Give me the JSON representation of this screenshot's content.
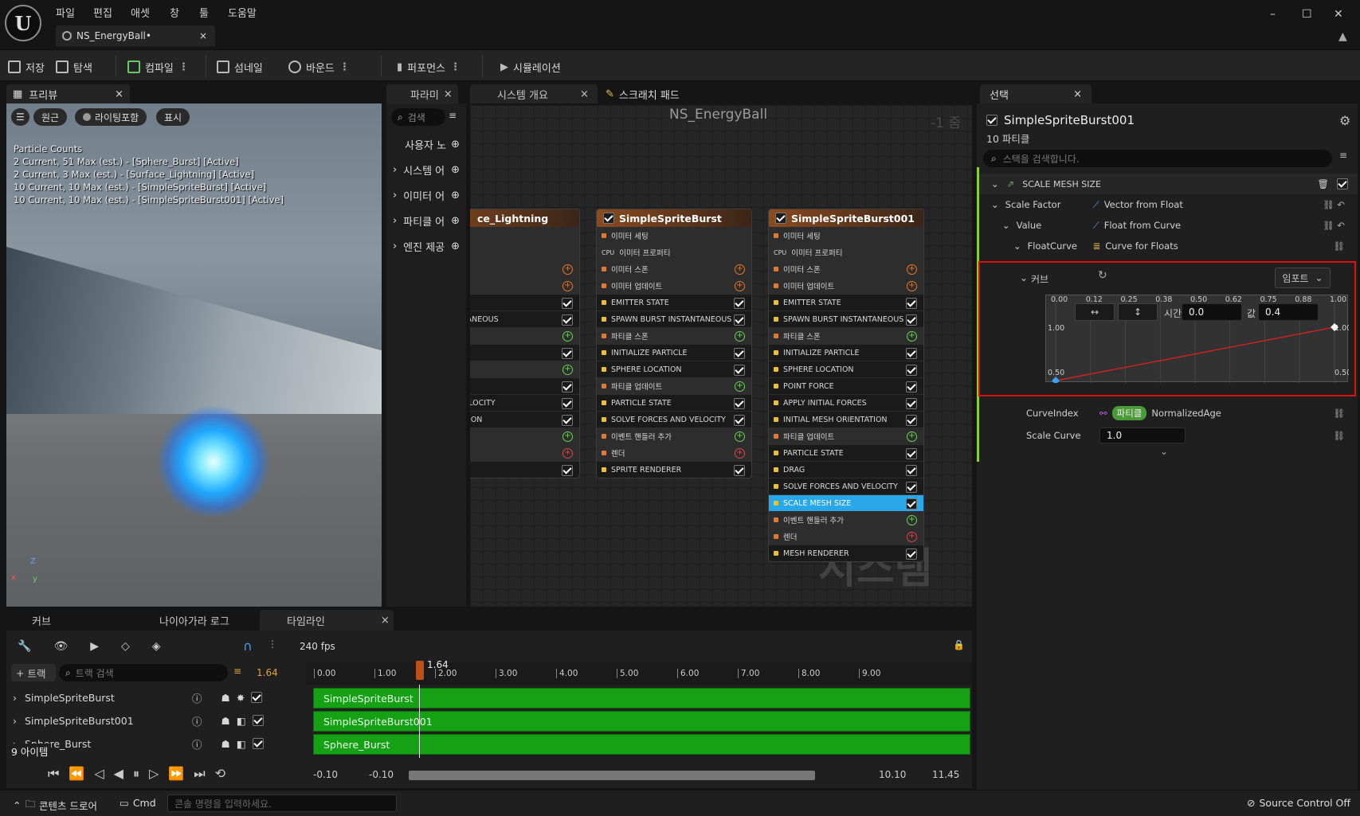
{
  "menu": [
    "파일",
    "편집",
    "애셋",
    "창",
    "툴",
    "도움말"
  ],
  "logo": "U",
  "doc_tab": {
    "title": "NS_EnergyBall•",
    "close": "×"
  },
  "window": {
    "minimize": "–",
    "maximize": "☐",
    "close": "✕"
  },
  "toolbar": {
    "save": "저장",
    "browse": "탐색",
    "compile": "컴파일",
    "thumbnail": "섬네일",
    "bounds": "바운드",
    "performance": "퍼포먼스",
    "simulation": "시뮬레이션"
  },
  "preview": {
    "tab": "프리뷰",
    "close": "×",
    "btn_persp": "원근",
    "btn_lit": "라이팅포함",
    "btn_show": "표시",
    "stats": [
      "Particle Counts",
      "2 Current, 51 Max (est.) - [Sphere_Burst] [Active]",
      "2 Current, 3 Max (est.) - [Surface_Lightning] [Active]",
      "10 Current, 10 Max (est.) - [SimpleSpriteBurst] [Active]",
      "10 Current, 10 Max (est.) - [SimpleSpriteBurst001] [Active]"
    ],
    "axis_z": "Z",
    "axis_x": "x",
    "axis_y": "y"
  },
  "graph": {
    "tabs": [
      "파라미",
      "시스템 개요",
      "스크래치 패드"
    ],
    "title": "NS_EnergyBall",
    "zoom": "-1 줌",
    "watermark": "시스템",
    "palette": {
      "search": "검색",
      "items": [
        "사용자 노",
        "시스템 어",
        "이미터 어",
        "파티클 어",
        "엔진 제공"
      ]
    },
    "node1": {
      "title": "ce_Lightning",
      "rows": [
        "팅",
        "로퍼티",
        "폰",
        "데이트",
        "I STATE",
        "BURST INSTANTANEOUS",
        "폰",
        "ZE PARTICLE",
        "데이트",
        "E STATE",
        "FORCES AND VELOCITY",
        "MESH ORIENTATION",
        "들러 추가",
        "",
        "ENDERER"
      ]
    },
    "node2": {
      "title": "SimpleSpriteBurst",
      "rows": [
        "이미터 세팅",
        "이미터 프로퍼티",
        "이미터 스폰",
        "이미터 업데이트",
        "EMITTER STATE",
        "SPAWN BURST INSTANTANEOUS",
        "파티클 스폰",
        "INITIALIZE PARTICLE",
        "SPHERE LOCATION",
        "파티클 업데이트",
        "PARTICLE STATE",
        "SOLVE FORCES AND VELOCITY",
        "이벤트 핸들러 추가",
        "렌더",
        "SPRITE RENDERER"
      ]
    },
    "node3": {
      "title": "SimpleSpriteBurst001",
      "rows": [
        "이미터 세팅",
        "이미터 프로퍼티",
        "이미터 스폰",
        "이미터 업데이트",
        "EMITTER STATE",
        "SPAWN BURST INSTANTANEOUS",
        "파티클 스폰",
        "INITIALIZE PARTICLE",
        "SPHERE LOCATION",
        "POINT FORCE",
        "APPLY INITIAL FORCES",
        "INITIAL MESH ORIENTATION",
        "파티클 업데이트",
        "PARTICLE STATE",
        "DRAG",
        "SOLVE FORCES AND VELOCITY",
        "SCALE MESH SIZE",
        "이벤트 핸들러 추가",
        "렌더",
        "MESH RENDERER"
      ]
    },
    "cpu": "CPU"
  },
  "details": {
    "tab": "선택",
    "close": "×",
    "name": "SimpleSpriteBurst001",
    "subtitle": "10 파티클",
    "search_placeholder": "스택을 검색합니다.",
    "section": "SCALE MESH SIZE",
    "scale_factor": {
      "label": "Scale Factor",
      "value": "Vector from Float"
    },
    "value": {
      "label": "Value",
      "value": "Float from Curve"
    },
    "float_curve": {
      "label": "FloatCurve",
      "value": "Curve for Floats"
    },
    "curve": {
      "label": "커브",
      "import": "임포트",
      "time_label": "시간",
      "time": "0.0",
      "value_label": "값",
      "value": "0.4",
      "ticks": [
        "0.00",
        "0.12",
        "0.25",
        "0.38",
        "0.50",
        "0.62",
        "0.75",
        "0.88",
        "1.00"
      ],
      "y_top": "1.00",
      "y_bottom": "0.50",
      "y_right_top": "1.00",
      "y_right_bottom": "0.50",
      "points": [
        [
          0.0,
          0.4
        ],
        [
          1.0,
          1.0
        ]
      ]
    },
    "curve_index": {
      "label": "CurveIndex",
      "badge": "파티클",
      "value": "NormalizedAge"
    },
    "scale_curve": {
      "label": "Scale Curve",
      "value": "1.0"
    }
  },
  "bottom_tabs": [
    "커브",
    "나이아가라 로그",
    "타임라인"
  ],
  "timeline": {
    "fps": "240 fps",
    "add_track": "트랙",
    "search_placeholder": "트랙 검색",
    "current": "1.64",
    "playhead": "1.64",
    "ruler": [
      "0.00",
      "1.00",
      "2.00",
      "3.00",
      "4.00",
      "5.00",
      "6.00",
      "7.00",
      "8.00",
      "9.00"
    ],
    "rows": [
      "SimpleSpriteBurst",
      "SimpleSpriteBurst001",
      "Sphere_Burst"
    ],
    "tracks": [
      "SimpleSpriteBurst",
      "SimpleSpriteBurst001",
      "Sphere_Burst"
    ],
    "item_count": "9 아이템",
    "range_start": "-0.10",
    "range_start2": "-0.10",
    "range_end": "10.10",
    "range_end2": "11.45"
  },
  "status": {
    "content_drawer": "콘텐츠 드로어",
    "cmd": "Cmd",
    "cmd_placeholder": "콘솔 명령을 입력하세요.",
    "source_control": "Source Control Off"
  }
}
